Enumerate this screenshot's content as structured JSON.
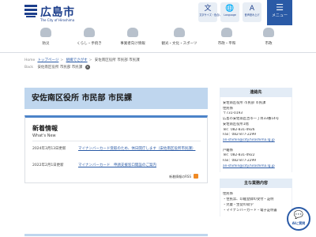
{
  "header": {
    "logo_text": "広島市",
    "logo_sub": "The City of Hiroshima",
    "buttons": [
      {
        "label": "文字サイズ・色合い変更",
        "icon": "文"
      },
      {
        "label": "Language",
        "icon": "🌐"
      },
      {
        "label": "音声読み上げ",
        "icon": "A"
      },
      {
        "label": "サイト内検索",
        "icon": "🔍"
      }
    ],
    "menu_label": "メニュー",
    "menu_icon": "☰"
  },
  "nav": [
    {
      "label": "防災"
    },
    {
      "label": "くらし・手続き"
    },
    {
      "label": "事業者向け情報"
    },
    {
      "label": "観光・文化・スポーツ"
    },
    {
      "label": "市政・平和"
    },
    {
      "label": "市政"
    }
  ],
  "breadcrumb": {
    "home_tag": "Home",
    "path": [
      "トップページ",
      "組織でさがす",
      "安佐南区役所 市民部 市民課"
    ],
    "current_tag": "Back",
    "current": "安佐南区役所 市民部 市民課"
  },
  "page": {
    "title": "安佐南区役所 市民部 市民課"
  },
  "news": {
    "heading": "新着情報",
    "heading_en": "What's New",
    "items": [
      {
        "date": "2024年3月13日更新",
        "text": "マイナンバーカード受取のため、休日開庁します（安佐南区役所市民課）"
      },
      {
        "date": "2022年2月1日更新",
        "text": "マイナンバーカード　申請支援窓口開設のご案内"
      }
    ],
    "rss_label": "新着情報のRSS"
  },
  "sidebar": {
    "contact_heading": "連絡先",
    "contact_lines": [
      "安佐南区役所 市民部 市民課",
      "住民係",
      "〒731-0193",
      "広島市安佐南区古市一丁目33番14号",
      "安佐南区役所1階",
      "Tel：082-831-4926",
      "Fax：082-877-2299"
    ],
    "contact_mail": "an-shimin@city.hiroshima.lg.jp",
    "contact2_lines": [
      "戸籍係",
      "Tel：082-831-4922",
      "Fax：082-877-2299"
    ],
    "contact2_mail": "an-shimin@city.hiroshima.lg.jp",
    "duties_heading": "主な業務内容",
    "duties_lines": [
      "住民係",
      "・住民票、印鑑登録の受付・証明",
      "・児童・生徒の就学",
      "・マイナンバーカード・電子証明書"
    ]
  },
  "ai_badge": {
    "label": "AIに質問",
    "icon": "💬"
  }
}
